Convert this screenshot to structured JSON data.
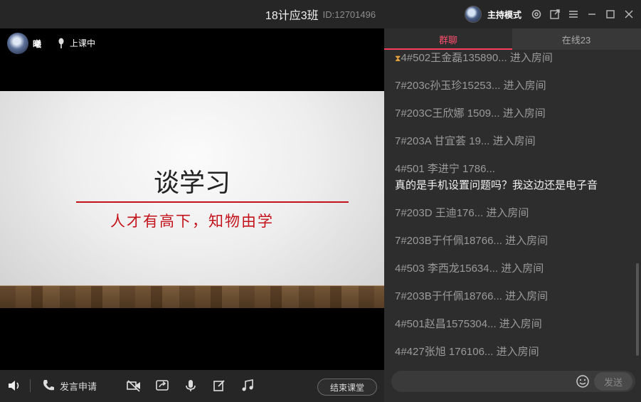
{
  "window": {
    "title": "18计应3班",
    "room_id": "ID:12701496",
    "mode_label": "主持模式"
  },
  "presenter": {
    "name": "曦",
    "status": "上课中"
  },
  "slide": {
    "title": "谈学习",
    "subtitle": "人才有高下，知物由学"
  },
  "toolbar": {
    "apply_label": "发言申请",
    "end_class_label": "结束课堂"
  },
  "panel": {
    "tabs": [
      {
        "label": "群聊",
        "active": true
      },
      {
        "label": "在线23",
        "active": false
      }
    ],
    "messages": [
      {
        "name": "4#502王金磊135890...",
        "content": " 进入房间",
        "body": "",
        "icon": "hourglass-icon"
      },
      {
        "name": "7#203c孙玉珍15253...",
        "content": " 进入房间",
        "body": ""
      },
      {
        "name": "7#203C王欣娜 1509...",
        "content": " 进入房间",
        "body": ""
      },
      {
        "name": "7#203A 甘宜荟  19...",
        "content": " 进入房间",
        "body": ""
      },
      {
        "name": "4#501 李进宁 1786...",
        "content": "",
        "body": "真的是手机设置问题吗？我这边还是电子音"
      },
      {
        "name": "7#203D    王迪176...",
        "content": " 进入房间",
        "body": ""
      },
      {
        "name": "7#203B于仟佩18766...",
        "content": " 进入房间",
        "body": ""
      },
      {
        "name": "4#503 李西龙15634...",
        "content": " 进入房间",
        "body": ""
      },
      {
        "name": "7#203B于仟佩18766...",
        "content": " 进入房间",
        "body": ""
      },
      {
        "name": "4#501赵昌1575304...",
        "content": " 进入房间",
        "body": ""
      },
      {
        "name": "4#427张旭 176106...",
        "content": " 进入房间",
        "body": ""
      }
    ],
    "input_placeholder": "",
    "send_label": "发送"
  }
}
